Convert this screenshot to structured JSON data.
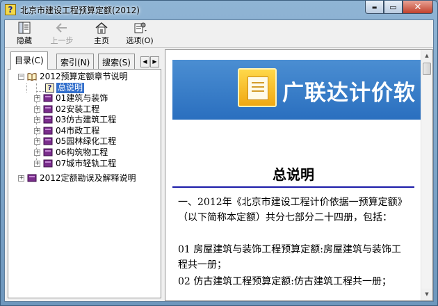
{
  "window": {
    "title": "北京市建设工程预算定额(2012)"
  },
  "caption_buttons": {
    "minimize": "▬",
    "maximize": "▭",
    "close": "✕"
  },
  "toolbar": {
    "items": [
      {
        "label": "隐藏",
        "icon": "hide-panel-icon",
        "enabled": true
      },
      {
        "label": "上一步",
        "icon": "back-arrow-icon",
        "enabled": false
      },
      {
        "label": "主页",
        "icon": "home-icon",
        "enabled": true
      },
      {
        "label": "选项(O)",
        "icon": "options-icon",
        "enabled": true
      }
    ]
  },
  "tabs": [
    {
      "label": "目录(C)",
      "active": true
    },
    {
      "label": "索引(N)",
      "active": false
    },
    {
      "label": "搜索(S)",
      "active": false
    }
  ],
  "tab_scroll": {
    "left": "◀",
    "right": "▶"
  },
  "tree": {
    "root": {
      "label": "2012预算定额章节说明",
      "expander": "−"
    },
    "selected_topic": "总说明",
    "chapters": [
      {
        "label": "01建筑与装饰",
        "expander": "+"
      },
      {
        "label": "02安装工程",
        "expander": "+"
      },
      {
        "label": "03仿古建筑工程",
        "expander": "+"
      },
      {
        "label": "04市政工程",
        "expander": "+"
      },
      {
        "label": "05园林绿化工程",
        "expander": "+"
      },
      {
        "label": "06构筑物工程",
        "expander": "+"
      },
      {
        "label": "07城市轻轨工程",
        "expander": "+"
      }
    ],
    "second_root": {
      "label": "2012定额勘误及解释说明",
      "expander": "+"
    }
  },
  "content": {
    "banner_text": "广联达计价软",
    "doc_title": "总说明",
    "paragraphs": [
      "一、2012年《北京市建设工程计价依据一预算定额》（以下简称本定额）共分七部分二十四册，包括：",
      "01 房屋建筑与装饰工程预算定额:房屋建筑与装饰工程共一册；",
      "02 仿古建筑工程预算定额:仿古建筑工程共一册；"
    ]
  },
  "scrollbar": {
    "up": "▲",
    "down": "▼"
  },
  "colors": {
    "banner": "#2f74c4",
    "selection": "#3470cc",
    "rule": "#1a1aa8",
    "book": "#7a2d8c"
  }
}
